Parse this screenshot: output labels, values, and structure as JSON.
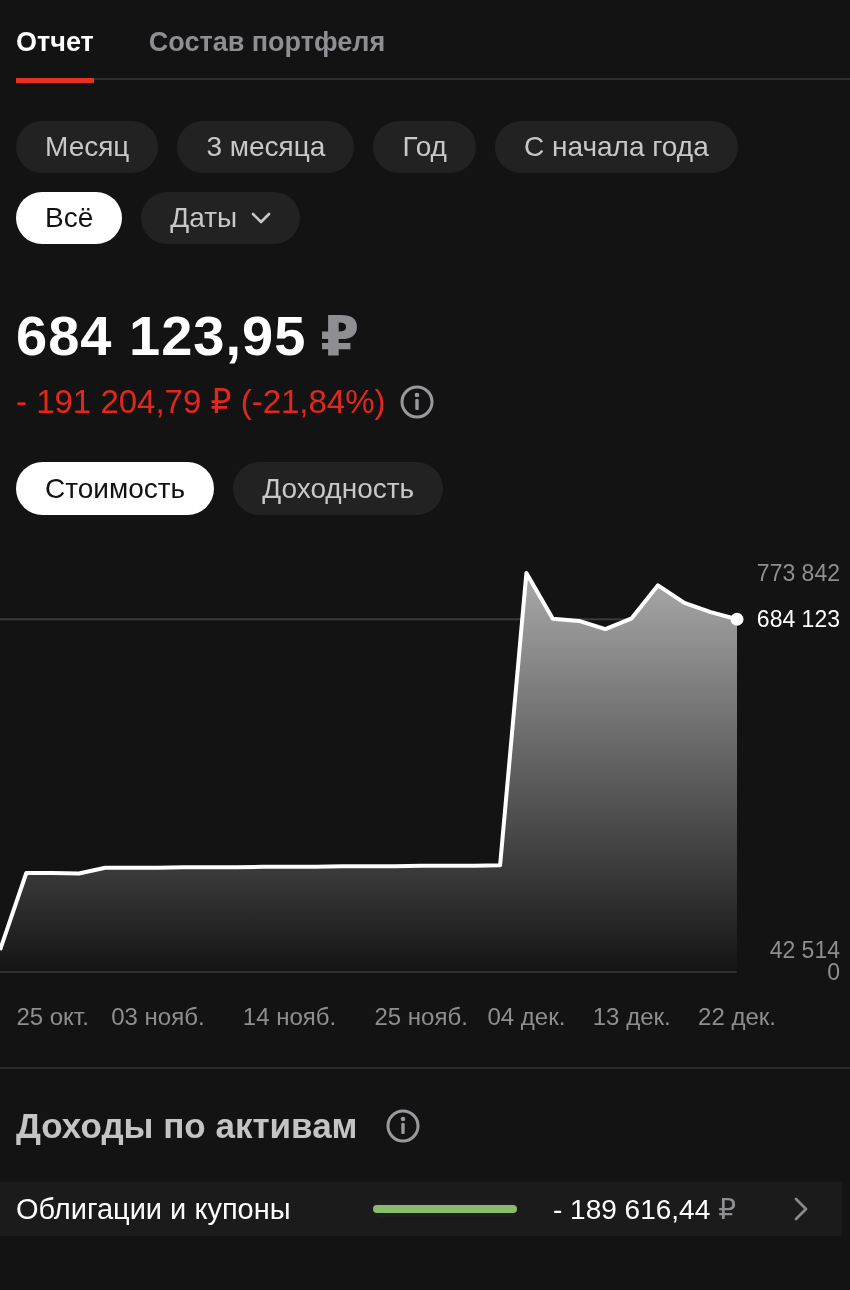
{
  "tabs": [
    {
      "label": "Отчет",
      "selected": true
    },
    {
      "label": "Состав портфеля",
      "selected": false
    }
  ],
  "periods": [
    {
      "label": "Месяц",
      "kind": "preset",
      "selected": false
    },
    {
      "label": "3 месяца",
      "kind": "preset",
      "selected": false
    },
    {
      "label": "Год",
      "kind": "preset",
      "selected": false
    },
    {
      "label": "С начала года",
      "kind": "preset",
      "selected": false
    },
    {
      "label": "Всё",
      "kind": "preset",
      "selected": true
    },
    {
      "label": "Даты",
      "kind": "dropdown",
      "selected": false
    }
  ],
  "summary": {
    "value": "684 123,95",
    "currency": "₽",
    "change": "- 191 204,79 ₽ (-21,84%)"
  },
  "view_modes": [
    {
      "label": "Стоимость",
      "selected": true
    },
    {
      "label": "Доходность",
      "selected": false
    }
  ],
  "chart": {
    "chart_data": {
      "type": "area",
      "categories": [
        null,
        null,
        "25 окт.",
        null,
        null,
        null,
        "03 нояб.",
        null,
        null,
        null,
        null,
        "14 нояб.",
        null,
        null,
        null,
        null,
        "25 нояб.",
        null,
        null,
        null,
        "04 дек.",
        null,
        null,
        null,
        "13 дек.",
        null,
        null,
        null,
        "22 дек."
      ],
      "values": [
        42514,
        192000,
        192000,
        191000,
        202000,
        202000,
        202000,
        203000,
        203000,
        203000,
        204000,
        204000,
        204000,
        205000,
        205000,
        205000,
        206000,
        206000,
        206000,
        207000,
        773842,
        685000,
        681000,
        665000,
        686000,
        750000,
        716000,
        698000,
        684123
      ],
      "ylim": [
        0,
        773842
      ],
      "yticks": [
        0,
        {
          "value": 42514,
          "label": "42 514"
        },
        {
          "value": 684123,
          "label": "684 123"
        },
        {
          "value": 773842,
          "label": "773 842"
        }
      ]
    }
  },
  "income_by_asset": {
    "title": "Доходы по активам",
    "rows": [
      {
        "name": "Облигации и купоны",
        "level": 1,
        "amount": "- 189 616,44",
        "currency": "₽"
      }
    ]
  }
}
